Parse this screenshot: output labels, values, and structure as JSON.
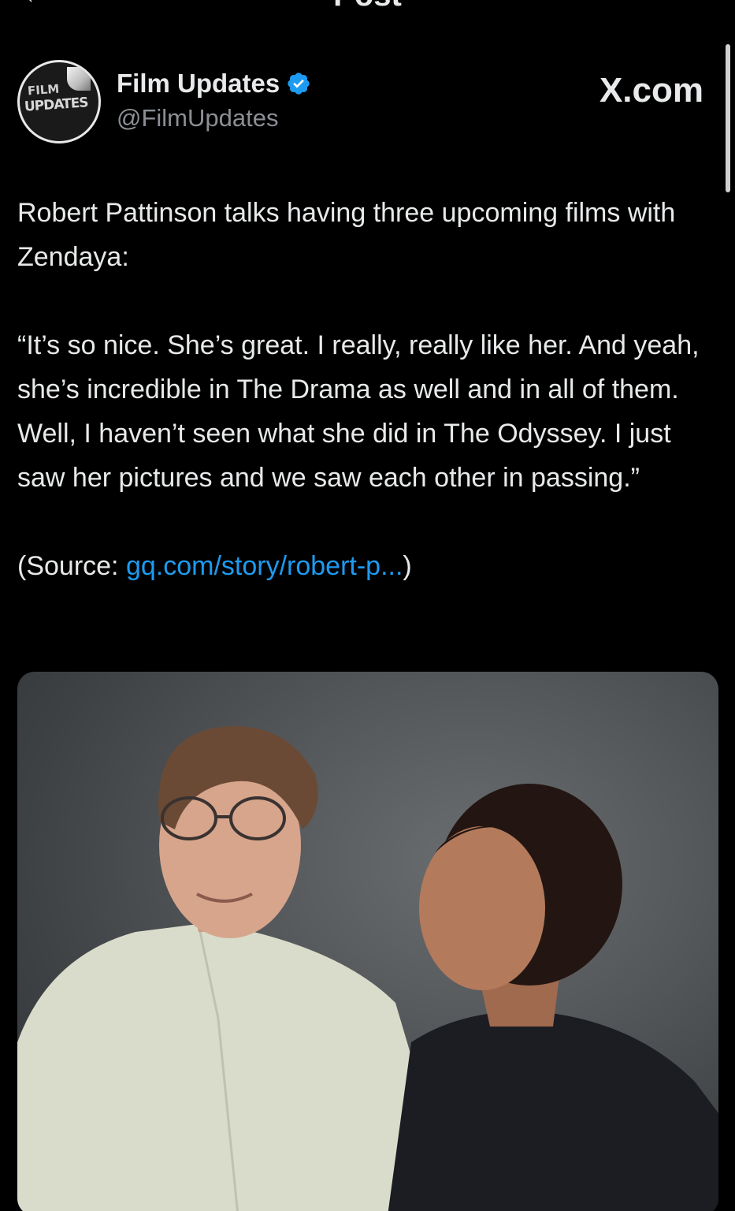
{
  "header": {
    "title": "Post",
    "back_icon": "back-arrow-icon"
  },
  "author": {
    "display_name": "Film Updates",
    "handle": "@FilmUpdates",
    "avatar_text_top": "FILM",
    "avatar_text_bottom": "UPDATES",
    "verified_icon": "verified-badge-icon",
    "verified_color": "#1d9bf0"
  },
  "brand": "X.com",
  "post": {
    "line1": "Robert Pattinson talks having three upcoming films with Zendaya:",
    "quote": "“It’s so nice. She’s great. I really, really like her. And yeah, she’s incredible in The Drama as well and in all of them. Well, I haven’t seen what she did in The Odyssey. I just saw her pictures and we saw each other in passing.”",
    "source_prefix": "(Source: ",
    "source_link": "gq.com/story/robert-p...",
    "source_suffix": ")"
  },
  "colors": {
    "background": "#000000",
    "text": "#e7e9ea",
    "secondary": "#8b8f94",
    "link": "#1d9bf0"
  }
}
